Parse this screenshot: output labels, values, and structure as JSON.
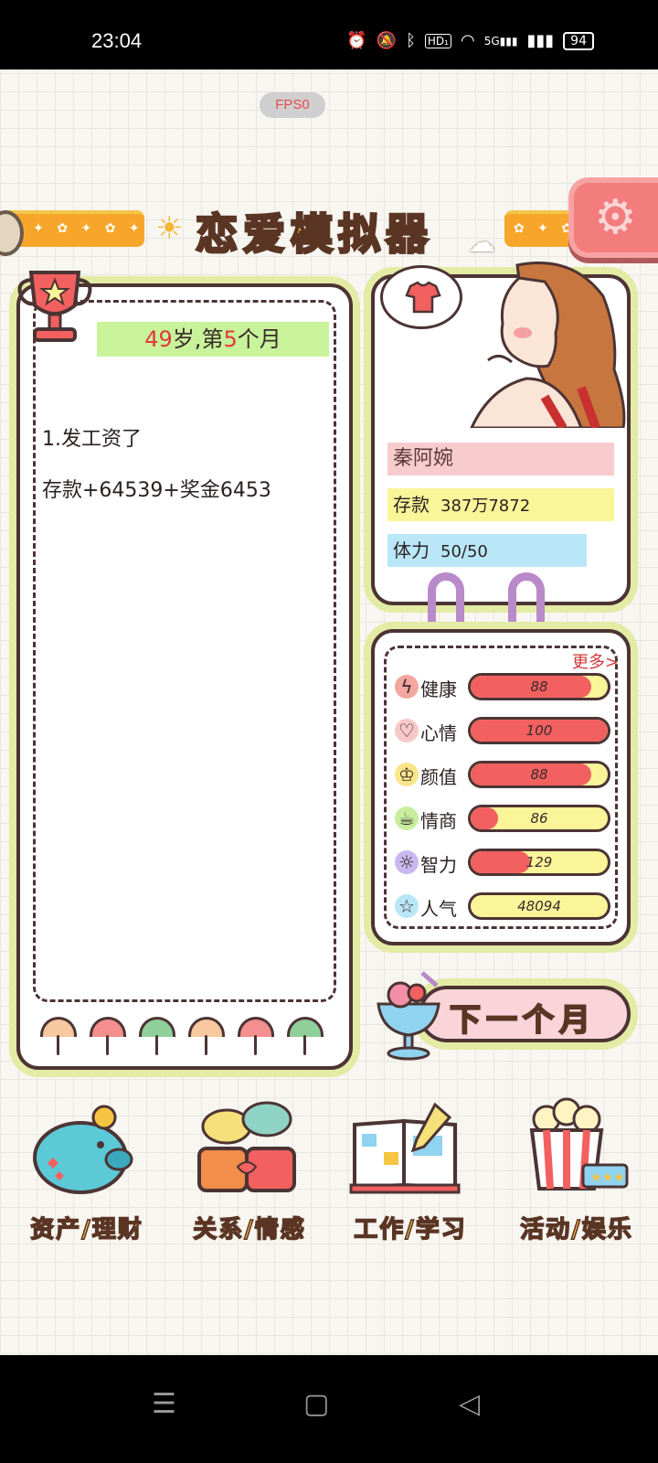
{
  "status_bar": {
    "time": "23:04",
    "icons": [
      "alarm-icon",
      "mute-icon",
      "bluetooth-icon",
      "hd-icon",
      "wifi-icon",
      "5g-signal-icon",
      "signal-icon"
    ],
    "hd_label": "HD₁",
    "network_5g": "5G",
    "battery": "94"
  },
  "fps_badge": "FPS0",
  "app_title": "恋爱模拟器",
  "log": {
    "age_number": "49",
    "age_suffix": "岁,第",
    "month_number": "5",
    "month_suffix": "个月",
    "events": [
      "1.发工资了",
      "存款+64539+奖金6453"
    ]
  },
  "character": {
    "name": "秦阿婉",
    "savings_label": "存款",
    "savings_value": "387万7872",
    "stamina_label": "体力",
    "stamina_value": "50/50"
  },
  "stats": {
    "more_label": "更多>",
    "items": [
      {
        "label": "健康",
        "value": "88",
        "fill": 0.88,
        "icon": "lightning-icon",
        "icon_bg": "#f4a6a0"
      },
      {
        "label": "心情",
        "value": "100",
        "fill": 1.0,
        "icon": "heart-icon",
        "icon_bg": "#f7c8c8"
      },
      {
        "label": "颜值",
        "value": "88",
        "fill": 0.88,
        "icon": "crown-icon",
        "icon_bg": "#fbe58a"
      },
      {
        "label": "情商",
        "value": "86",
        "fill": 0.2,
        "icon": "teacup-icon",
        "icon_bg": "#c7ee9f"
      },
      {
        "label": "智力",
        "value": "129",
        "fill": 0.43,
        "icon": "lightbulb-icon",
        "icon_bg": "#c9b8ef"
      },
      {
        "label": "人气",
        "value": "48094",
        "fill": 0.0,
        "icon": "star-icon",
        "icon_bg": "#b9e7f8"
      }
    ]
  },
  "next_month_label": "下一个月",
  "bottom_menu": [
    {
      "label": "资产/理财",
      "icon": "piggy-bank-icon"
    },
    {
      "label": "关系/情感",
      "icon": "couple-mugs-icon"
    },
    {
      "label": "工作/学习",
      "icon": "open-book-icon"
    },
    {
      "label": "活动/娱乐",
      "icon": "popcorn-icon"
    }
  ],
  "colors": {
    "accent_yellow": "#f7c444",
    "outline_brown": "#4c3434",
    "panel_border_green": "#e3eba4",
    "bar_red": "#f26060",
    "bar_yellow": "#fbf59a"
  }
}
